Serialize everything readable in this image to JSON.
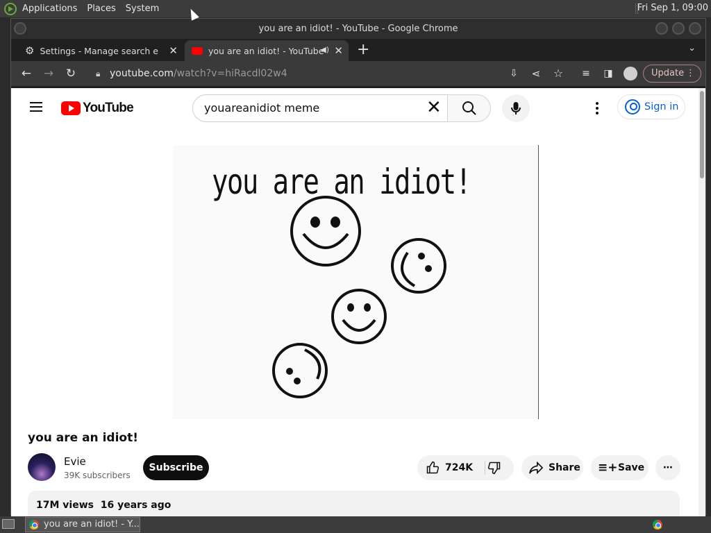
{
  "system_panel": {
    "menus": [
      "Applications",
      "Places",
      "System"
    ],
    "clock": "Fri Sep  1, 09:00"
  },
  "window": {
    "title": "you are an idiot! - YouTube - Google Chrome"
  },
  "tabs": [
    {
      "label": "Settings - Manage search engi",
      "icon": "gear-icon",
      "active": false
    },
    {
      "label": "you are an idiot! - YouTube",
      "icon": "youtube-icon",
      "active": true
    }
  ],
  "toolbar": {
    "url_host": "youtube.com",
    "url_path": "/watch?v=hiRacdl02w4",
    "update_label": "Update"
  },
  "youtube": {
    "logo_text": "YouTube",
    "search_value": "youareanidiot meme",
    "signin_label": "Sign in",
    "video_caption": "you are an idiot!",
    "video_title": "you are an idiot!",
    "channel_name": "Evie",
    "subscribers": "39K subscribers",
    "subscribe_label": "Subscribe",
    "likes": "724K",
    "share_label": "Share",
    "save_label": "Save",
    "views": "17M views",
    "age": "16 years ago"
  },
  "taskbar": {
    "task_label": "you are an idiot! - Y..."
  },
  "colors": {
    "youtube_red": "#ff0000",
    "signin_blue": "#065fd4",
    "chrome_dark": "#3a3a3a"
  }
}
